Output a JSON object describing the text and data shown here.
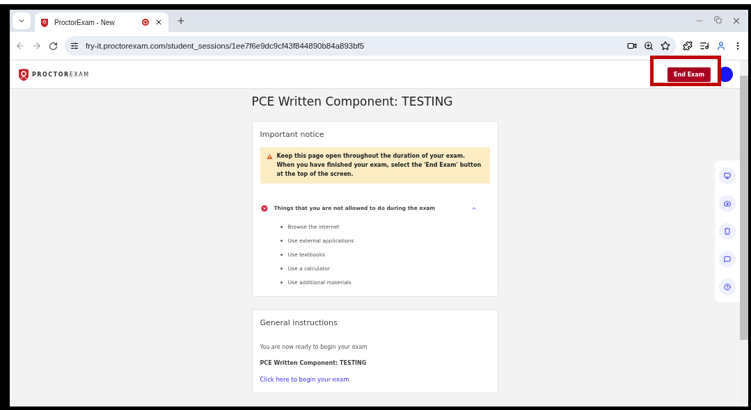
{
  "browser": {
    "tab_title": "ProctorExam - New",
    "url": "fry-it.proctorexam.com/student_sessions/1ee7f6e9dc9cf43f844890b84a893bf5"
  },
  "header": {
    "logo": "**PROCTOR**EXAM",
    "end_button": "End Exam"
  },
  "exam_title": "PCE Written Component: TESTING",
  "notice": {
    "heading": "Important notice",
    "warning": "Keep this page open throughout the duration of your exam. When you have finished your exam, select the 'End Exam' button at the top of the screen.",
    "rules": {
      "heading": "Things that you are not allowed to do during the exam",
      "expanded": true,
      "items": [
        "Browse the internet",
        "Use external applications",
        "Use textbooks",
        "Use a calculator",
        "Use additional materials"
      ]
    }
  },
  "instructions": {
    "heading": "General instructions",
    "text": "You are now ready to begin your exam",
    "exam_name": "PCE Written Component: TESTING",
    "link": "Click here to begin your exam"
  }
}
